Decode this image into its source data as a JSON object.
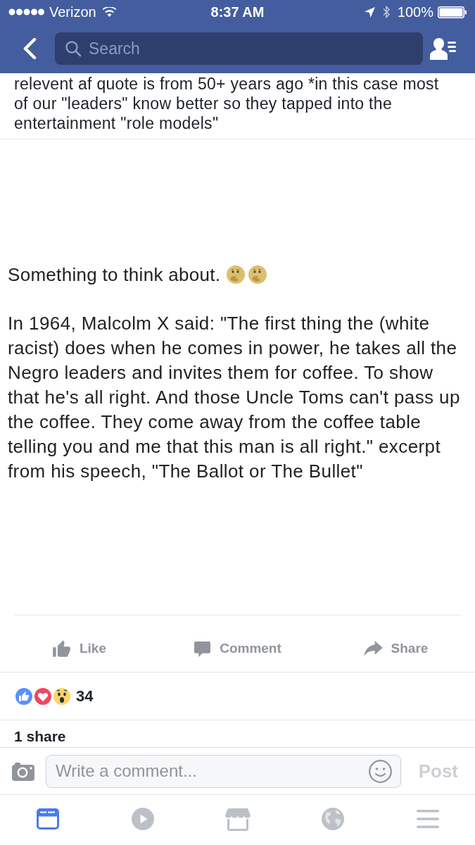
{
  "status_bar": {
    "carrier": "Verizon",
    "time": "8:37 AM",
    "battery": "100%"
  },
  "nav_bar": {
    "search": {
      "placeholder": "Search"
    }
  },
  "previous_comment": {
    "lines": [
      "relevent af quote is from 50+ years ago *in this case most",
      "of our \"leaders\" know better so they tapped into the",
      "entertainment \"role models\""
    ]
  },
  "post": {
    "intro": "Something to think about.",
    "intro_emojis": [
      {
        "kind": "thinking"
      },
      {
        "kind": "thinking"
      }
    ],
    "body_lines": [
      "In 1964, Malcolm X said: \"The first thing the (white",
      "racist) does when he comes in power, he takes all the",
      "Negro leaders and invites them for coffee. To show",
      "that he's all right. And those Uncle Toms can't pass up",
      "the coffee. They come away from the coffee table",
      "telling you and me that this man is all right.\" excerpt",
      "from his speech, \"The Ballot or The Bullet\""
    ]
  },
  "actions": [
    {
      "kind": "like",
      "label": "Like"
    },
    {
      "kind": "comment",
      "label": "Comment"
    },
    {
      "kind": "share",
      "label": "Share"
    }
  ],
  "reactions": {
    "icons": [
      {
        "kind": "like"
      },
      {
        "kind": "love"
      },
      {
        "kind": "wow"
      }
    ],
    "count": "34"
  },
  "shares": "1 share",
  "composer": {
    "placeholder": "Write a comment...",
    "post_label": "Post",
    "post_disabled": true
  },
  "tab_bar": [
    {
      "kind": "feed",
      "selected": true
    },
    {
      "kind": "video",
      "selected": false
    },
    {
      "kind": "marketplace",
      "selected": false
    },
    {
      "kind": "globe",
      "selected": false
    },
    {
      "kind": "menu",
      "selected": false
    }
  ]
}
